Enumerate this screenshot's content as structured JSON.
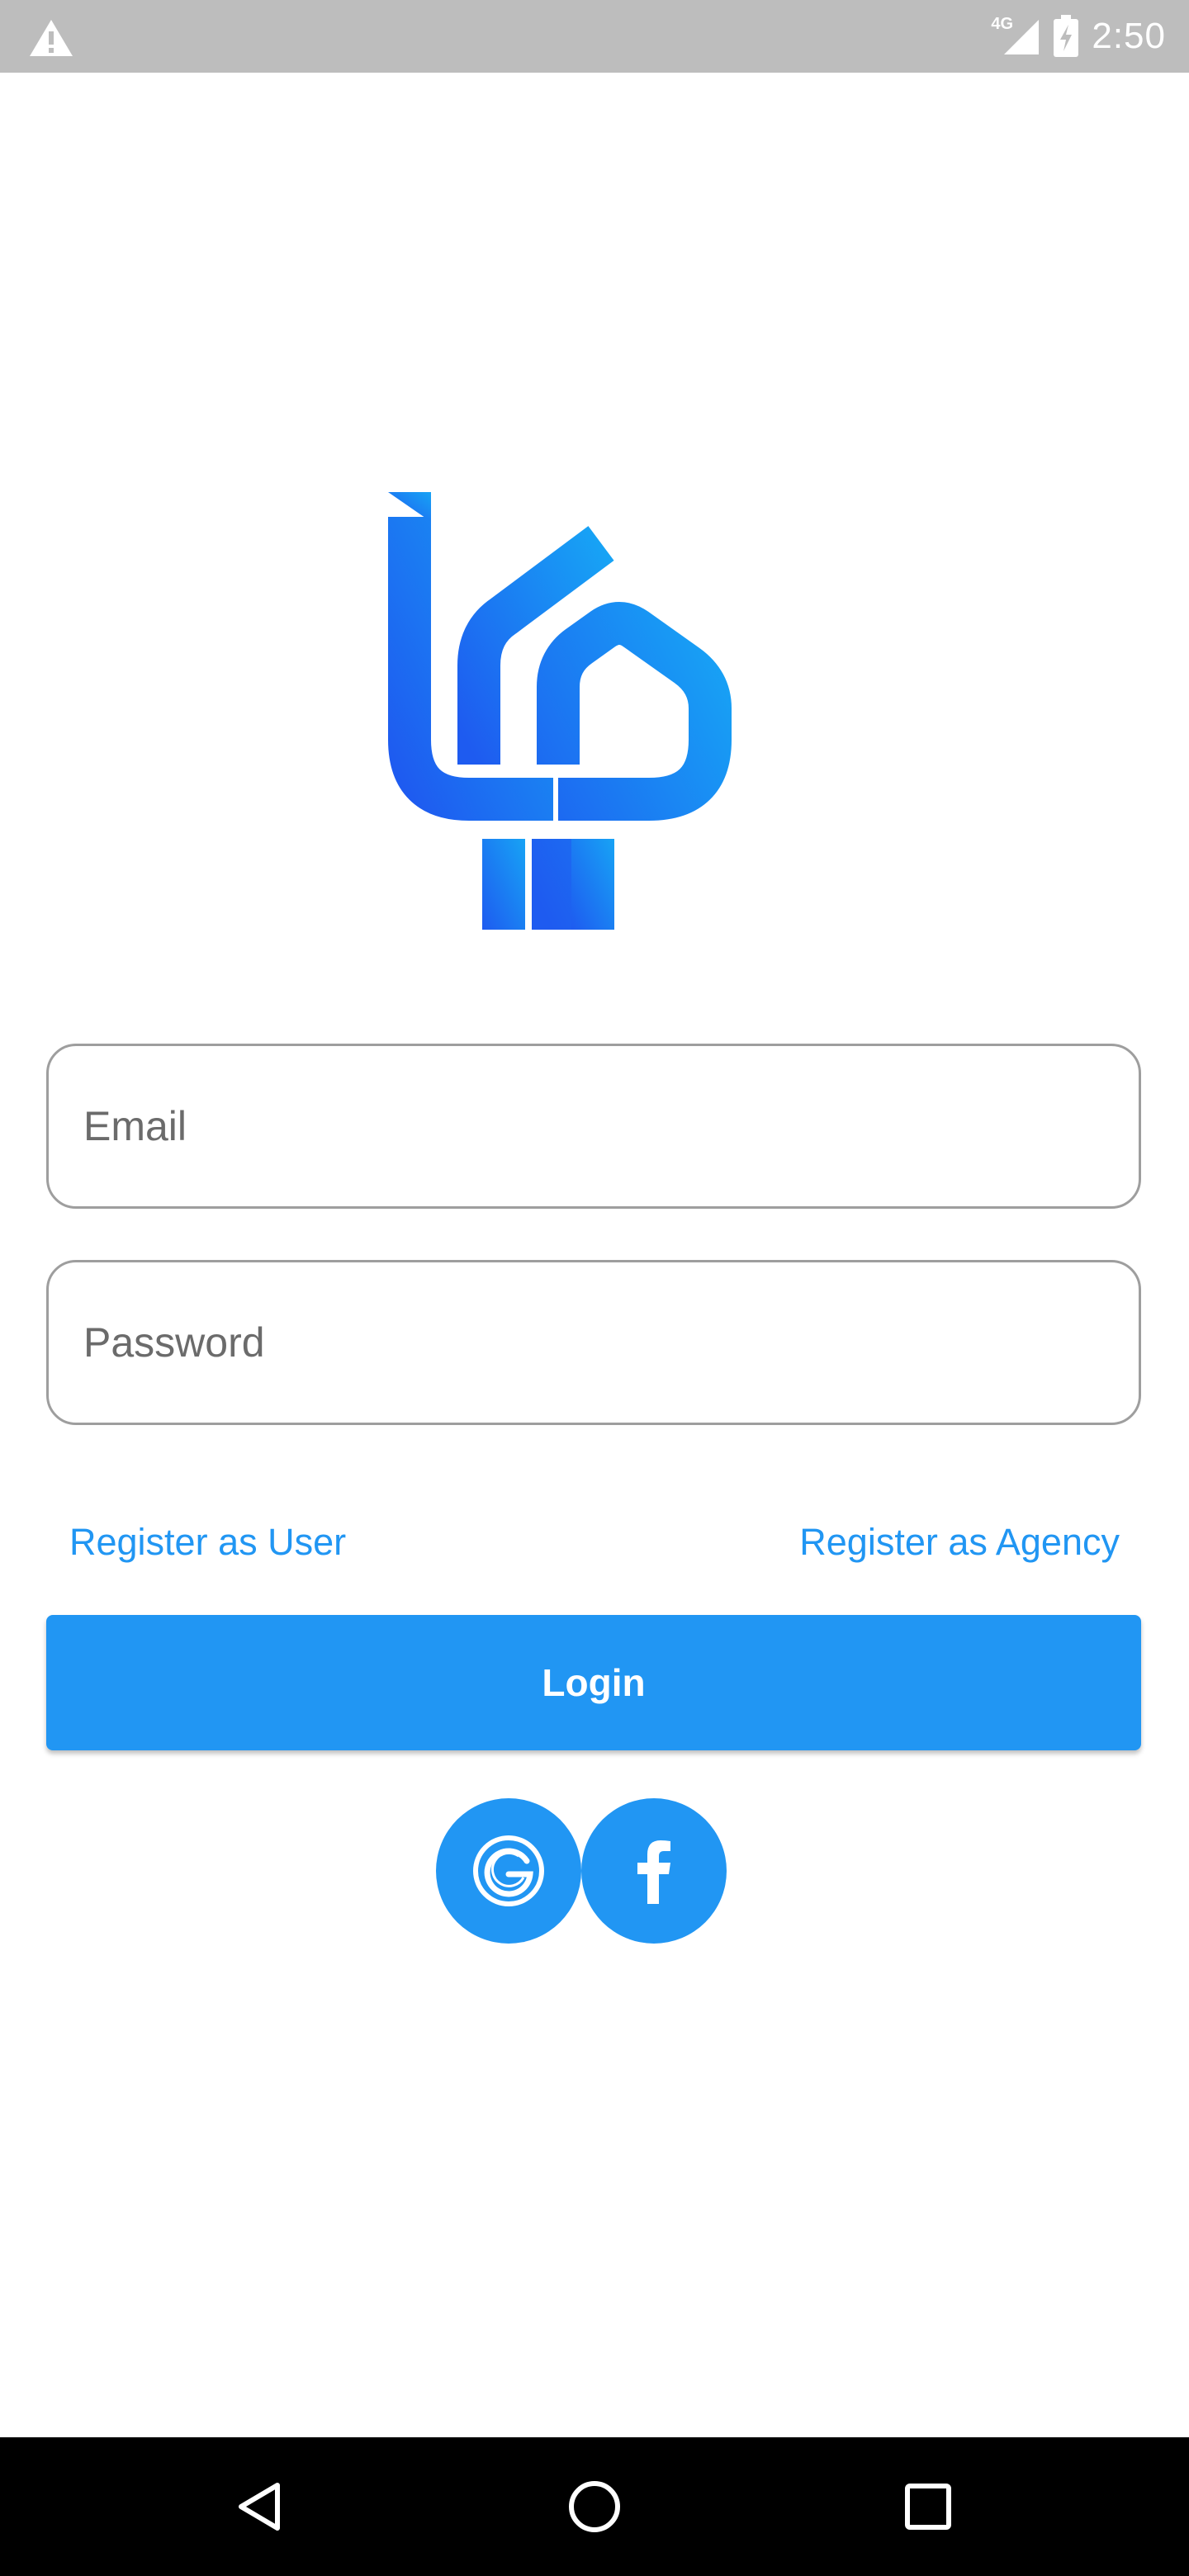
{
  "status_bar": {
    "network_label": "4G",
    "time": "2:50"
  },
  "icons": {
    "warning": "warning-icon",
    "signal": "signal-icon",
    "battery": "battery-charging-icon",
    "logo": "house-logo-icon",
    "google": "google-icon",
    "facebook": "facebook-icon",
    "back": "back-triangle-icon",
    "home": "home-circle-icon",
    "recents": "recents-square-icon"
  },
  "colors": {
    "accent": "#2196f3",
    "logo_gradient_start": "#1e5bf0",
    "logo_gradient_end": "#17a3f5",
    "status_bar": "#bdbdbd",
    "nav_bar": "#000000"
  },
  "form": {
    "email": {
      "placeholder": "Email",
      "value": ""
    },
    "password": {
      "placeholder": "Password",
      "value": ""
    }
  },
  "links": {
    "register_user": "Register as User",
    "register_agency": "Register as Agency"
  },
  "login_button": {
    "label": "Login"
  }
}
